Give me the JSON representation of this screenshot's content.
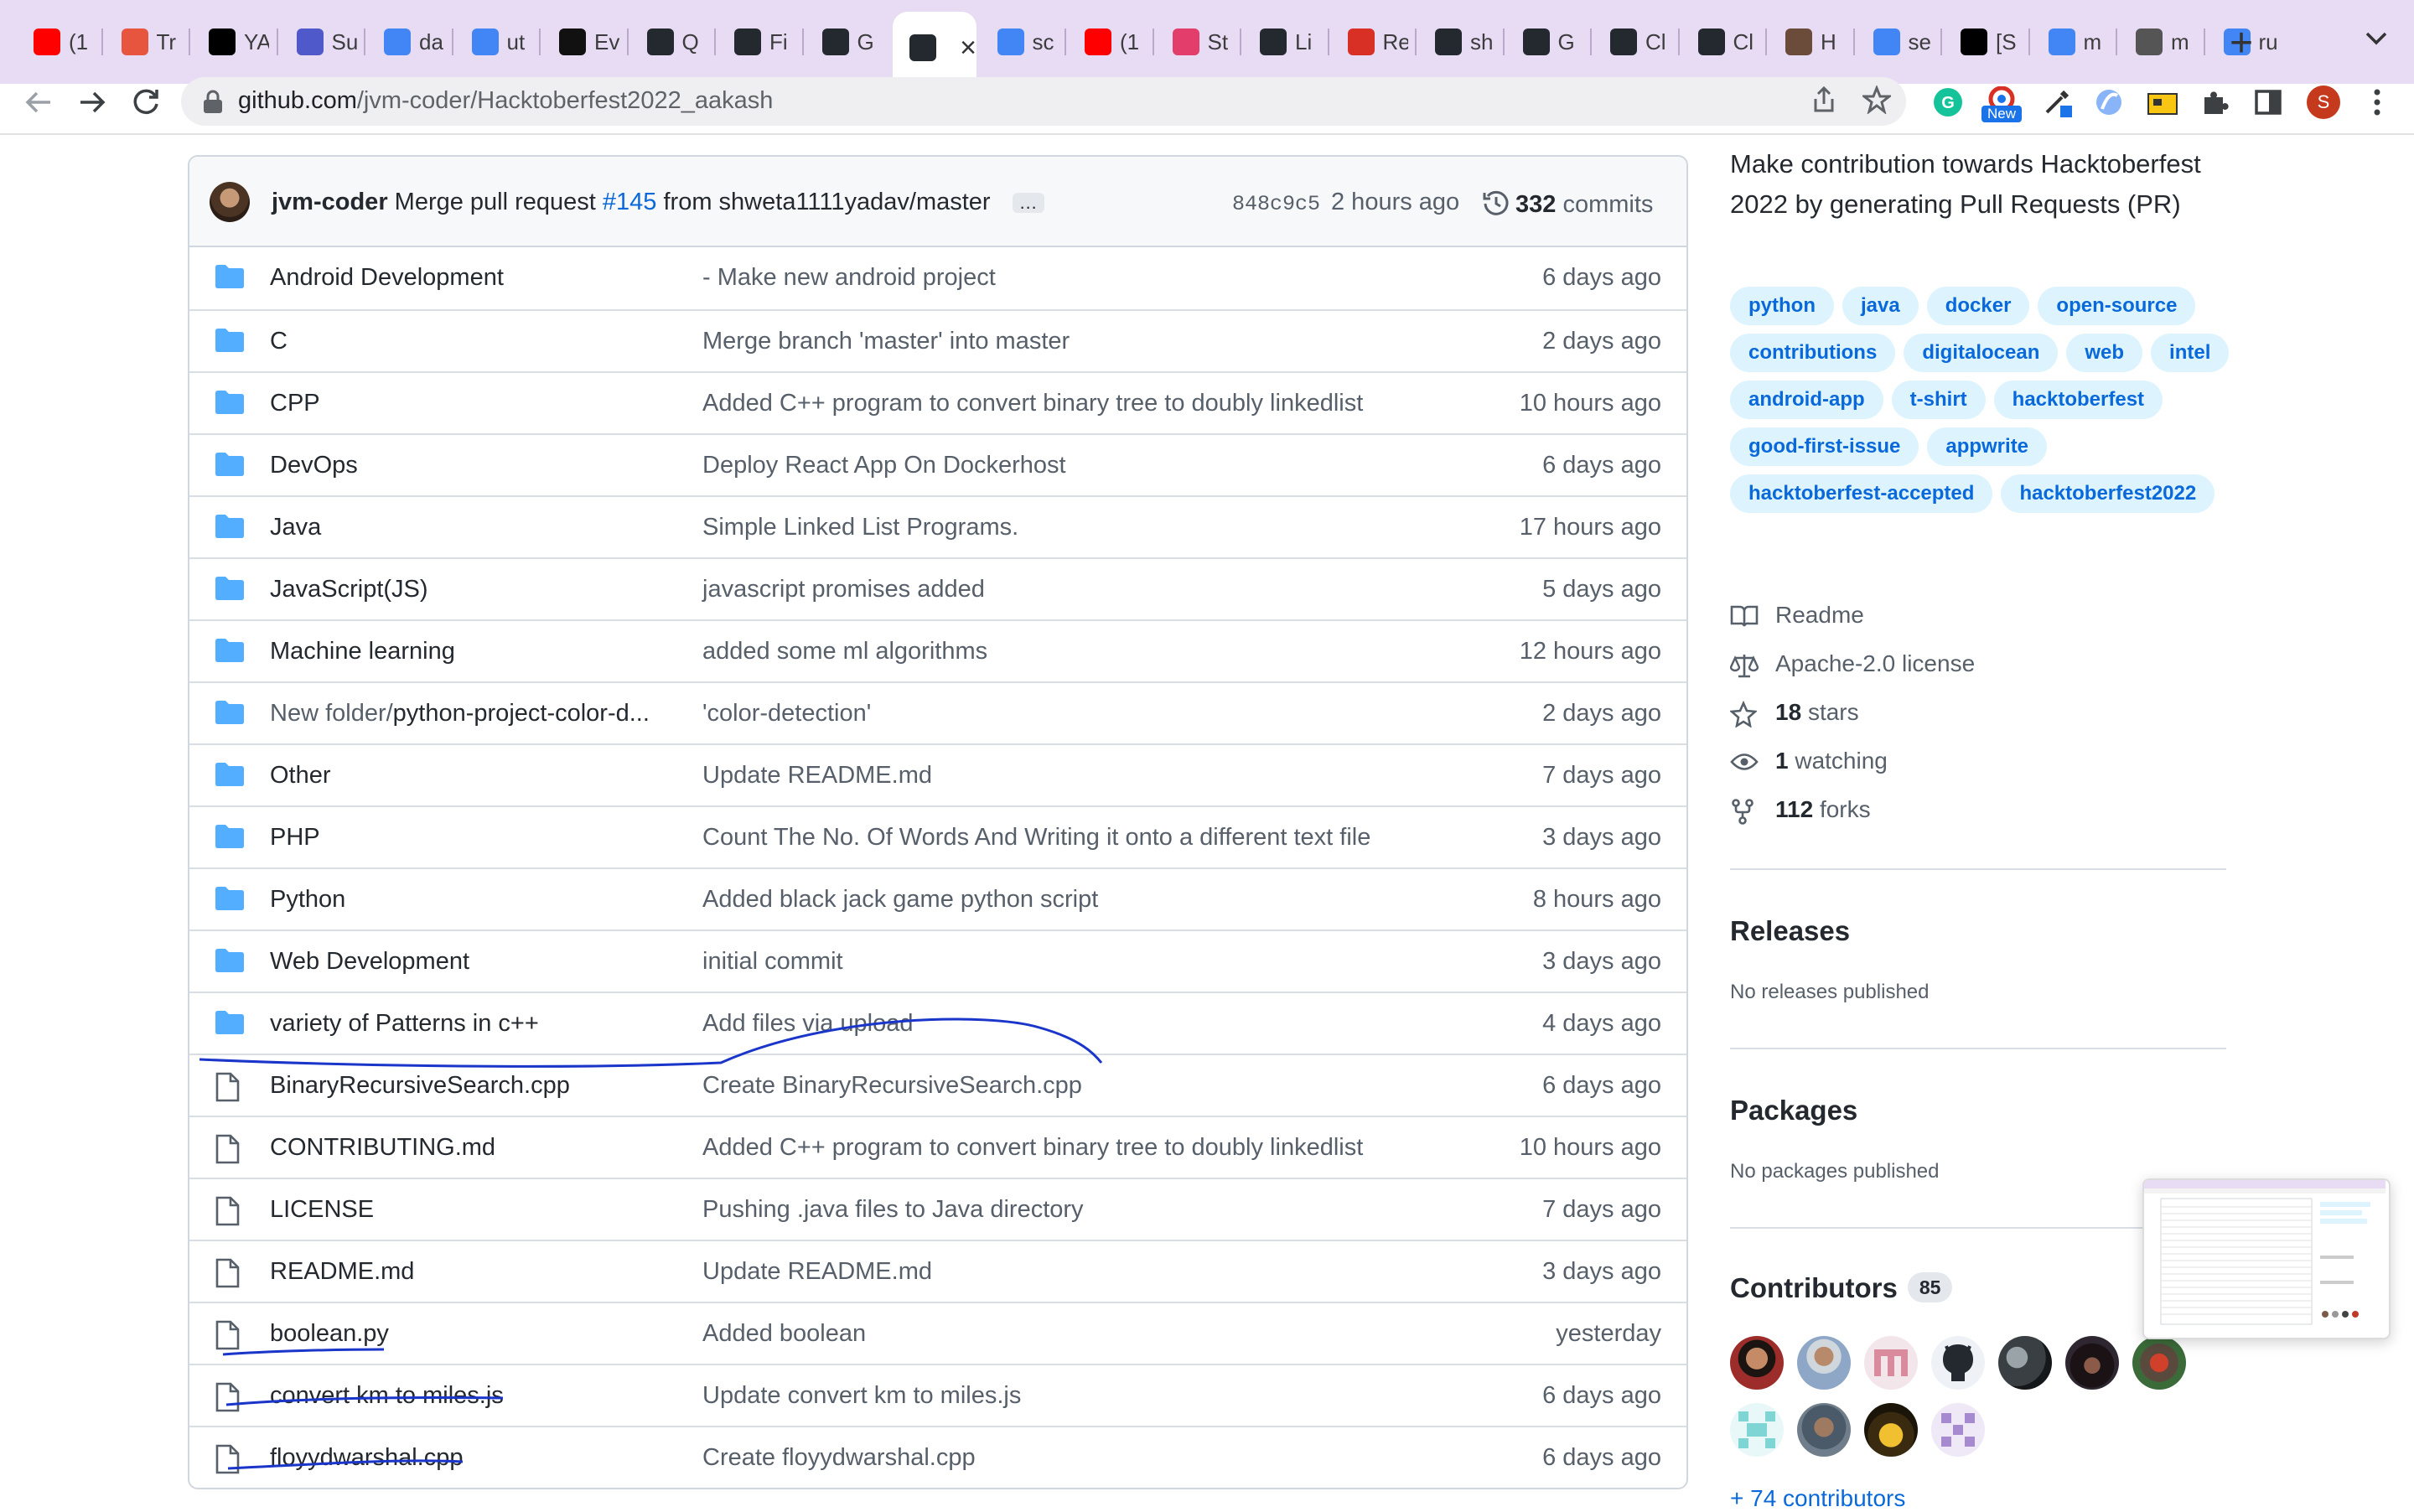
{
  "browser": {
    "tabs": [
      {
        "label": "(1",
        "favicon": "youtube-icon",
        "color": "#ff0000"
      },
      {
        "label": "Tr",
        "favicon": "tool-icon",
        "color": "#e8553f"
      },
      {
        "label": "YA",
        "favicon": "notion-icon",
        "color": "#000000"
      },
      {
        "label": "Su",
        "favicon": "teams-icon",
        "color": "#5059c9"
      },
      {
        "label": "da",
        "favicon": "google-icon",
        "color": "#4285f4"
      },
      {
        "label": "ut",
        "favicon": "google-icon",
        "color": "#4285f4"
      },
      {
        "label": "Ev",
        "favicon": "video-icon",
        "color": "#111111"
      },
      {
        "label": "Q",
        "favicon": "github-icon",
        "color": "#24292f"
      },
      {
        "label": "Fi",
        "favicon": "github-icon",
        "color": "#24292f"
      },
      {
        "label": "G",
        "favicon": "github-icon",
        "color": "#24292f"
      },
      {
        "label": "",
        "favicon": "github-icon",
        "color": "#24292f"
      },
      {
        "label": "sc",
        "favicon": "google-icon",
        "color": "#4285f4"
      },
      {
        "label": "(1",
        "favicon": "youtube-icon",
        "color": "#ff0000"
      },
      {
        "label": "St",
        "favicon": "s-icon",
        "color": "#e23d6b"
      },
      {
        "label": "Li",
        "favicon": "github-icon",
        "color": "#24292f"
      },
      {
        "label": "Re",
        "favicon": "gmail-icon",
        "color": "#d93025"
      },
      {
        "label": "sh",
        "favicon": "github-icon",
        "color": "#24292f"
      },
      {
        "label": "G",
        "favicon": "github-icon",
        "color": "#24292f"
      },
      {
        "label": "Cl",
        "favicon": "github-icon",
        "color": "#24292f"
      },
      {
        "label": "Cl",
        "favicon": "github-icon",
        "color": "#24292f"
      },
      {
        "label": "H",
        "favicon": "avatar-icon",
        "color": "#6b4b3a"
      },
      {
        "label": "se",
        "favicon": "google-icon",
        "color": "#4285f4"
      },
      {
        "label": "[S",
        "favicon": "dev-icon",
        "color": "#000000"
      },
      {
        "label": "m",
        "favicon": "google-icon",
        "color": "#4285f4"
      },
      {
        "label": "m",
        "favicon": "bike-icon",
        "color": "#555555"
      },
      {
        "label": "ru",
        "favicon": "google-icon",
        "color": "#4285f4"
      }
    ],
    "url_host": "github.com",
    "url_path": "/jvm-coder/Hacktoberfest2022_aakash",
    "new_badge": "New",
    "profile_initial": "S"
  },
  "commit": {
    "author": "jvm-coder",
    "message_prefix": "Merge pull request",
    "pr": "#145",
    "message_suffix": "from shweta1111yadav/master",
    "ellipsis": "…",
    "sha": "848c9c5",
    "time": "2 hours ago",
    "commit_count": "332",
    "commits_label": "commits"
  },
  "files": [
    {
      "type": "dir",
      "prefix": "",
      "name": "Android Development",
      "message": "- Make new android project",
      "age": "6 days ago"
    },
    {
      "type": "dir",
      "prefix": "",
      "name": "C",
      "message": "Merge branch 'master' into master",
      "age": "2 days ago"
    },
    {
      "type": "dir",
      "prefix": "",
      "name": "CPP",
      "message": "Added C++ program to convert binary tree to doubly linkedlist",
      "age": "10 hours ago"
    },
    {
      "type": "dir",
      "prefix": "",
      "name": "DevOps",
      "message": "Deploy React App On Dockerhost",
      "age": "6 days ago"
    },
    {
      "type": "dir",
      "prefix": "",
      "name": "Java",
      "message": "Simple Linked List Programs.",
      "age": "17 hours ago"
    },
    {
      "type": "dir",
      "prefix": "",
      "name": "JavaScript(JS)",
      "message": "javascript promises added",
      "age": "5 days ago"
    },
    {
      "type": "dir",
      "prefix": "",
      "name": "Machine learning",
      "message": "added some ml algorithms",
      "age": "12 hours ago"
    },
    {
      "type": "dir",
      "prefix": "New folder/",
      "name": "python-project-color-d...",
      "message": "'color-detection'",
      "age": "2 days ago"
    },
    {
      "type": "dir",
      "prefix": "",
      "name": "Other",
      "message": "Update README.md",
      "age": "7 days ago"
    },
    {
      "type": "dir",
      "prefix": "",
      "name": "PHP",
      "message": "Count The No. Of Words And Writing it onto a different text file",
      "age": "3 days ago"
    },
    {
      "type": "dir",
      "prefix": "",
      "name": "Python",
      "message": "Added black jack game python script",
      "age": "8 hours ago"
    },
    {
      "type": "dir",
      "prefix": "",
      "name": "Web Development",
      "message": "initial commit",
      "age": "3 days ago"
    },
    {
      "type": "dir",
      "prefix": "",
      "name": "variety of Patterns in c++",
      "message": "Add files via upload",
      "age": "4 days ago"
    },
    {
      "type": "file",
      "prefix": "",
      "name": "BinaryRecursiveSearch.cpp",
      "message": "Create BinaryRecursiveSearch.cpp",
      "age": "6 days ago"
    },
    {
      "type": "file",
      "prefix": "",
      "name": "CONTRIBUTING.md",
      "message": "Added C++ program to convert binary tree to doubly linkedlist",
      "age": "10 hours ago"
    },
    {
      "type": "file",
      "prefix": "",
      "name": "LICENSE",
      "message": "Pushing .java files to Java directory",
      "age": "7 days ago"
    },
    {
      "type": "file",
      "prefix": "",
      "name": "README.md",
      "message": "Update README.md",
      "age": "3 days ago"
    },
    {
      "type": "file",
      "prefix": "",
      "name": "boolean.py",
      "message": "Added boolean",
      "age": "yesterday"
    },
    {
      "type": "file",
      "prefix": "",
      "name": "convert km to miles.js",
      "message": "Update convert km to miles.js",
      "age": "6 days ago"
    },
    {
      "type": "file",
      "prefix": "",
      "name": "floyydwarshal.cpp",
      "message": "Create floyydwarshal.cpp",
      "age": "6 days ago"
    }
  ],
  "sidebar": {
    "about": "Make contribution towards Hacktoberfest 2022 by generating Pull Requests (PR)",
    "topics": [
      "python",
      "java",
      "docker",
      "open-source",
      "contributions",
      "digitalocean",
      "web",
      "intel",
      "android-app",
      "t-shirt",
      "hacktoberfest",
      "good-first-issue",
      "appwrite",
      "hacktoberfest-accepted",
      "hacktoberfest2022"
    ],
    "readme": "Readme",
    "license": "Apache-2.0 license",
    "stars_count": "18",
    "stars_label": "stars",
    "watching_count": "1",
    "watching_label": "watching",
    "forks_count": "112",
    "forks_label": "forks",
    "releases_title": "Releases",
    "releases_note": "No releases published",
    "packages_title": "Packages",
    "packages_note": "No packages published",
    "contributors_title": "Contributors",
    "contributors_count": "85",
    "more_contributors": "+ 74 contributors"
  },
  "colors": {
    "link": "#0969da",
    "folder": "#54aeff",
    "annotation_ink": "#1a35c9",
    "tabbar": "#e8dcf5"
  }
}
